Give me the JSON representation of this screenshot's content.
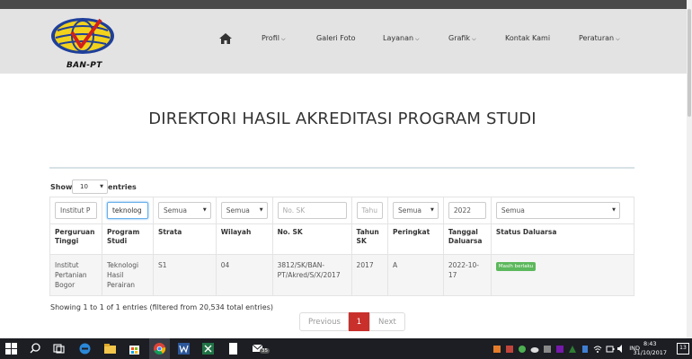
{
  "logo": {
    "text": "BAN-PT"
  },
  "nav": {
    "items": [
      "Profil",
      "Galeri Foto",
      "Layanan",
      "Grafik",
      "Kontak Kami",
      "Peraturan"
    ]
  },
  "page": {
    "title": "DIREKTORI HASIL AKREDITASI PROGRAM STUDI"
  },
  "length_control": {
    "prefix": "Show",
    "value": "10",
    "suffix": "entries"
  },
  "filters": {
    "perguruan_tinggi": "Institut P",
    "program_studi": "teknolog",
    "strata": "Semua",
    "wilayah": "Semua",
    "no_sk_placeholder": "No. SK",
    "tahun_placeholder": "Tahu",
    "peringkat": "Semua",
    "tanggal": "2022",
    "status": "Semua"
  },
  "table": {
    "headers": [
      "Perguruan Tinggi",
      "Program Studi",
      "Strata",
      "Wilayah",
      "No. SK",
      "Tahun SK",
      "Peringkat",
      "Tanggal Daluarsa",
      "Status Daluarsa"
    ],
    "rows": [
      {
        "perguruan_tinggi": "Institut Pertanian Bogor",
        "program_studi": "Teknologi Hasil Perairan",
        "strata": "S1",
        "wilayah": "04",
        "no_sk": "3812/SK/BAN-PT/Akred/S/X/2017",
        "tahun_sk": "2017",
        "peringkat": "A",
        "tanggal_daluarsa": "2022-10-17",
        "status_daluarsa": "Masih berlaku"
      }
    ]
  },
  "info": "Showing 1 to 1 of 1 entries (filtered from 20,534 total entries)",
  "pagination": {
    "prev": "Previous",
    "current": "1",
    "next": "Next"
  },
  "taskbar": {
    "language": "IND",
    "time": "8:43",
    "date": "31/10/2017",
    "notifications": "13",
    "edge_badge": "35"
  },
  "colors": {
    "header_bg": "#e3e3e3",
    "active_page": "#c9302c",
    "badge": "#5cb85c",
    "taskbar": "#1c1e24"
  }
}
